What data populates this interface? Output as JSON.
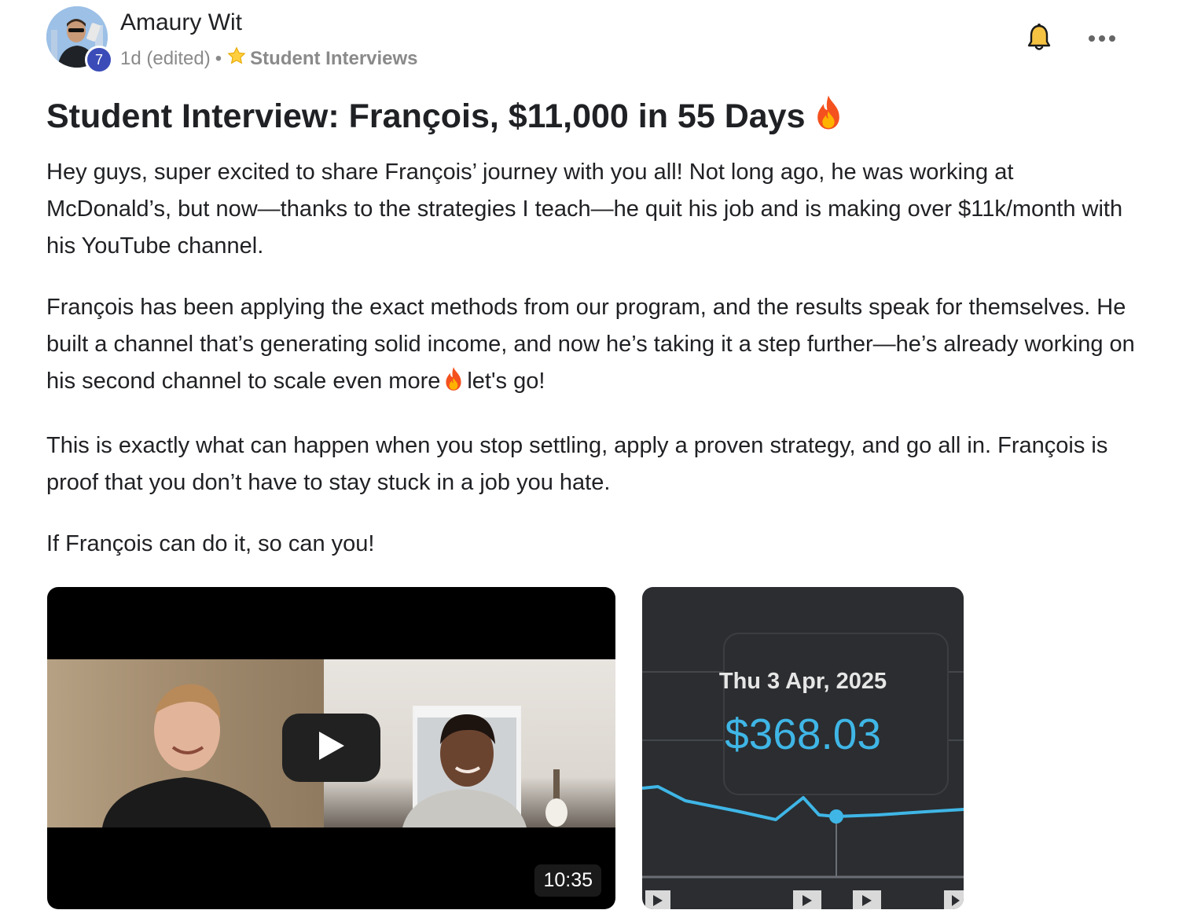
{
  "author": {
    "name": "Amaury Wit",
    "level": "7",
    "avatar": "avatar-photo"
  },
  "meta": {
    "time": "1d (edited)",
    "separator": "•",
    "category_icon": "star-icon",
    "category": "Student Interviews"
  },
  "actions": {
    "bell_icon": "bell-icon",
    "more_icon": "more-horizontal-icon"
  },
  "post": {
    "title": "Student Interview: François, $11,000 in 55 Days",
    "title_emoji": "fire-icon",
    "paragraphs": [
      "Hey guys, super excited to share François’ journey with you all! Not long ago, he was working at McDonald’s, but now—thanks to the strategies I teach—he quit his job and is making over $11k/month with his YouTube channel.",
      "François has been applying the exact methods from our program, and the results speak for themselves. He built a channel that’s generating solid income, and now he’s taking it a step further—he’s already working on his second channel to scale even more",
      "let's go!",
      "This is exactly what can happen when you stop settling, apply a proven strategy, and go all in. François is proof that you don’t have to stay stuck in a job you hate.",
      "If François can do it, so can you!"
    ]
  },
  "attachments": {
    "video": {
      "duration": "10:35",
      "play_icon": "play-icon"
    },
    "chart_screenshot": {
      "date": "Thu 3 Apr, 2025",
      "value": "$368.03",
      "accent_color": "#3fb6e6",
      "background_color": "#2b2d30"
    }
  }
}
